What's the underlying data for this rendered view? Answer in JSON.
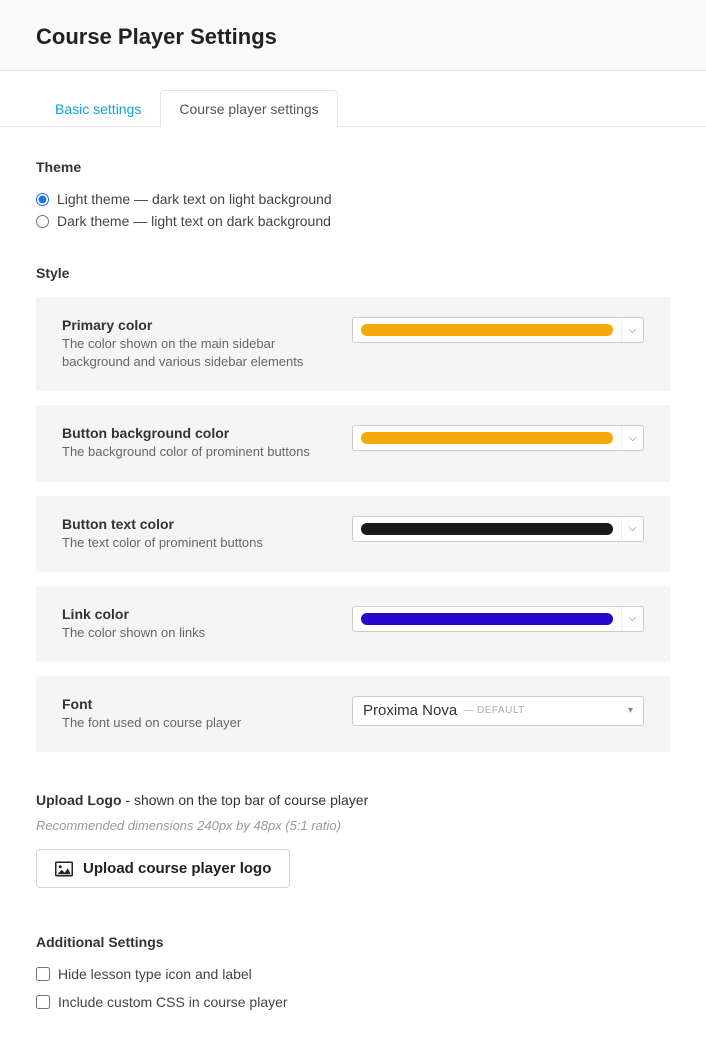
{
  "header": {
    "title": "Course Player Settings"
  },
  "tabs": {
    "basic": "Basic settings",
    "player": "Course player settings"
  },
  "theme": {
    "label": "Theme",
    "options": {
      "light": "Light theme — dark text on light background",
      "dark": "Dark theme — light text on dark background"
    },
    "selected": "light"
  },
  "style": {
    "label": "Style",
    "primary": {
      "title": "Primary color",
      "desc": "The color shown on the main sidebar background and various sidebar elements",
      "color": "#f5a90a"
    },
    "button_bg": {
      "title": "Button background color",
      "desc": "The background color of prominent buttons",
      "color": "#f5a90a"
    },
    "button_text": {
      "title": "Button text color",
      "desc": "The text color of prominent buttons",
      "color": "#1a1a1a"
    },
    "link": {
      "title": "Link color",
      "desc": "The color shown on links",
      "color": "#2408cc"
    },
    "font": {
      "title": "Font",
      "desc": "The font used on course player",
      "value": "Proxima Nova",
      "default_label": "— DEFAULT"
    }
  },
  "upload": {
    "title_bold": "Upload Logo",
    "title_rest": " - shown on the top bar of course player",
    "hint": "Recommended dimensions 240px by 48px (5:1 ratio)",
    "button": "Upload course player logo"
  },
  "additional": {
    "label": "Additional Settings",
    "hide_icon": "Hide lesson type icon and label",
    "custom_css": "Include custom CSS in course player"
  }
}
